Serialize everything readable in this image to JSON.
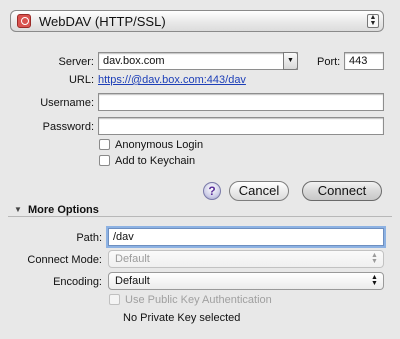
{
  "protocol": {
    "label": "WebDAV (HTTP/SSL)",
    "icon": "webdav-icon"
  },
  "server": {
    "label": "Server:",
    "value": "dav.box.com"
  },
  "port": {
    "label": "Port:",
    "value": "443"
  },
  "url": {
    "label": "URL:",
    "value": "https://@dav.box.com:443/dav"
  },
  "username": {
    "label": "Username:",
    "value": ""
  },
  "password": {
    "label": "Password:",
    "value": ""
  },
  "checkboxes": {
    "anonymous": "Anonymous Login",
    "keychain": "Add to Keychain"
  },
  "buttons": {
    "help": "?",
    "cancel": "Cancel",
    "connect": "Connect"
  },
  "more_options": {
    "label": "More Options"
  },
  "path": {
    "label": "Path:",
    "value": "/dav"
  },
  "connect_mode": {
    "label": "Connect Mode:",
    "value": "Default"
  },
  "encoding": {
    "label": "Encoding:",
    "value": "Default"
  },
  "public_key": {
    "label": "Use Public Key Authentication"
  },
  "private_key_status": "No Private Key selected",
  "colors": {
    "link": "#1d3fb8",
    "background": "#e8e8e8",
    "focus_ring": "#8db2e3"
  }
}
